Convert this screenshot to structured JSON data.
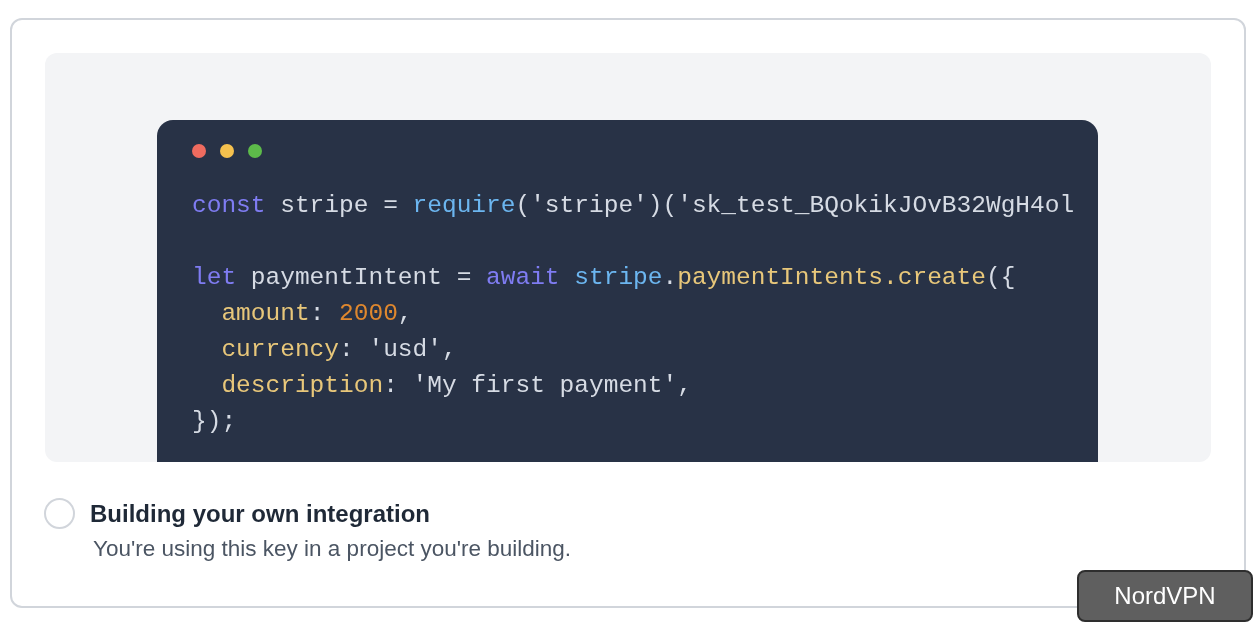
{
  "code_window": {
    "blocks": [
      [
        [
          {
            "kind": "keyword",
            "text": "const"
          },
          {
            "kind": "plain",
            "text": " stripe = "
          },
          {
            "kind": "function",
            "text": "require"
          },
          {
            "kind": "plain",
            "text": "('stripe')('sk_test_BQokikJOvB32WgH4ol"
          }
        ]
      ],
      [
        [
          {
            "kind": "keyword",
            "text": "let"
          },
          {
            "kind": "plain",
            "text": " paymentIntent = "
          },
          {
            "kind": "keyword",
            "text": "await "
          },
          {
            "kind": "function",
            "text": "stripe"
          },
          {
            "kind": "plain",
            "text": "."
          },
          {
            "kind": "property",
            "text": "paymentIntents.create"
          },
          {
            "kind": "plain",
            "text": "({"
          }
        ],
        [
          {
            "kind": "property",
            "text": "  amount"
          },
          {
            "kind": "plain",
            "text": ": "
          },
          {
            "kind": "number",
            "text": "2000"
          },
          {
            "kind": "plain",
            "text": ","
          }
        ],
        [
          {
            "kind": "property",
            "text": "  currency"
          },
          {
            "kind": "plain",
            "text": ": 'usd',"
          }
        ],
        [
          {
            "kind": "property",
            "text": "  description"
          },
          {
            "kind": "plain",
            "text": ": 'My first payment',"
          }
        ],
        [
          {
            "kind": "plain",
            "text": "});"
          }
        ]
      ]
    ]
  },
  "option": {
    "title": "Building your own integration",
    "description": "You're using this key in a project you're building.",
    "selected": false
  },
  "tooltip": "NordVPN"
}
